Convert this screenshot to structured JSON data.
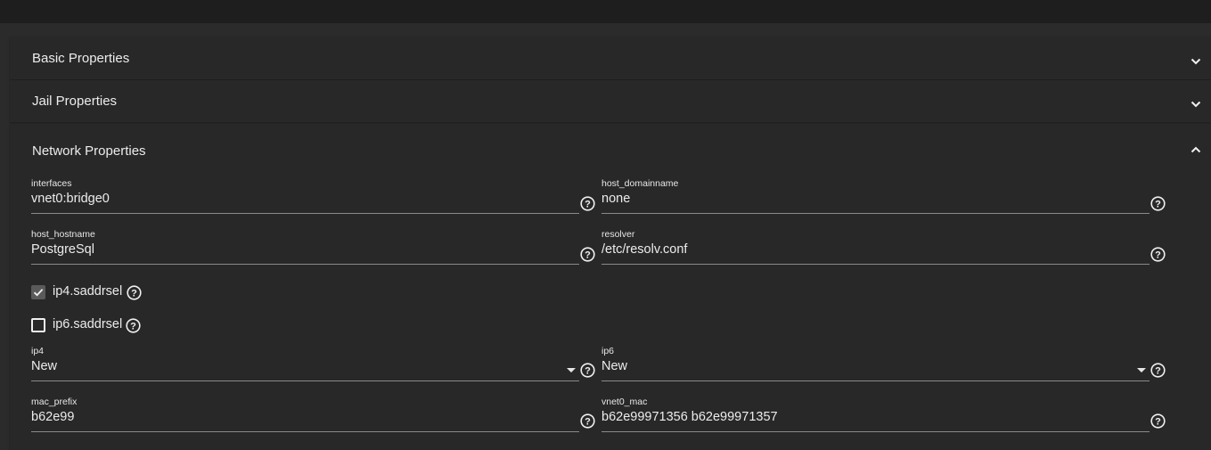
{
  "panels": {
    "basic": {
      "title": "Basic Properties",
      "expanded": false
    },
    "jail": {
      "title": "Jail Properties",
      "expanded": false
    },
    "network": {
      "title": "Network Properties",
      "expanded": true
    }
  },
  "fields": {
    "interfaces": {
      "label": "interfaces",
      "value": "vnet0:bridge0"
    },
    "host_domainname": {
      "label": "host_domainname",
      "value": "none"
    },
    "host_hostname": {
      "label": "host_hostname",
      "value": "PostgreSql"
    },
    "resolver": {
      "label": "resolver",
      "value": "/etc/resolv.conf"
    },
    "ip4": {
      "label": "ip4",
      "value": "New"
    },
    "ip6": {
      "label": "ip6",
      "value": "New"
    },
    "mac_prefix": {
      "label": "mac_prefix",
      "value": "b62e99"
    },
    "vnet0_mac": {
      "label": "vnet0_mac",
      "value": "b62e99971356 b62e99971357"
    }
  },
  "checkboxes": {
    "ip4_saddrsel": {
      "label": "ip4.saddrsel",
      "checked": true
    },
    "ip6_saddrsel": {
      "label": "ip6.saddrsel",
      "checked": false
    }
  },
  "icons": {
    "help": "help-circle-icon",
    "expand": "chevron-down-icon",
    "collapse": "chevron-up-icon",
    "dropdown": "caret-down-icon",
    "check": "check-icon"
  },
  "colors": {
    "background": "#2b2b2b",
    "panel": "#282828",
    "topbar": "#1e1e1e",
    "text": "#ececec",
    "underline": "#8a8a8a"
  }
}
